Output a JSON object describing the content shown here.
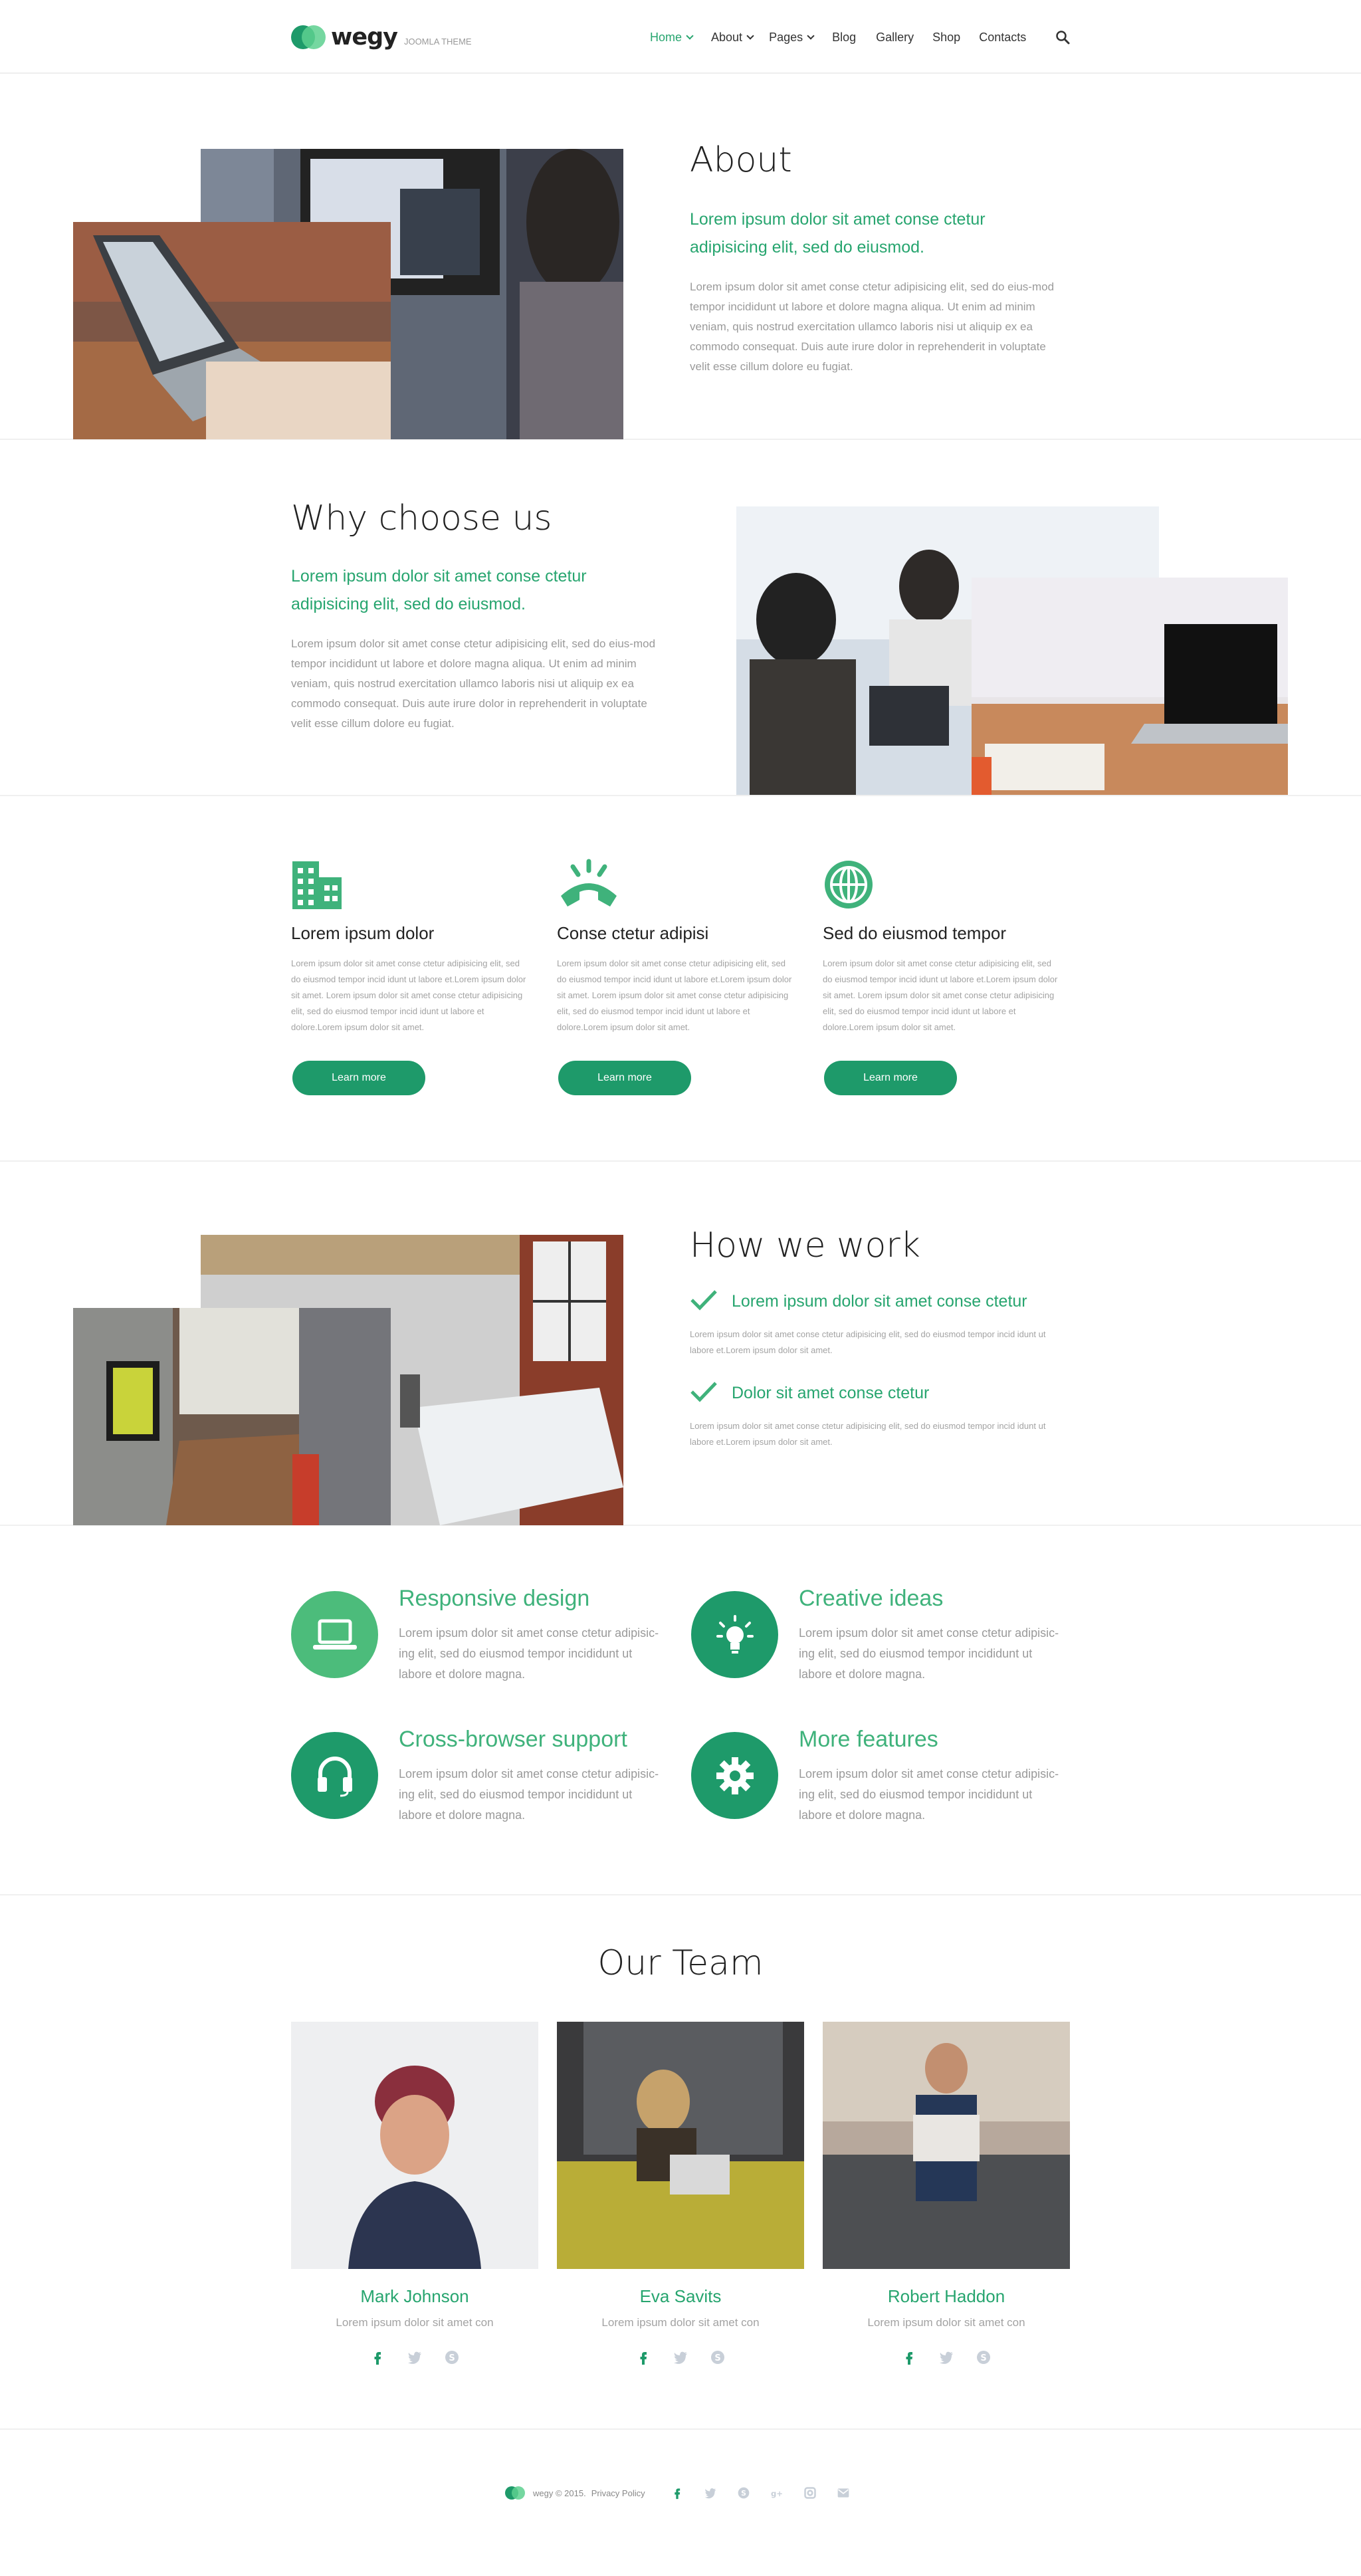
{
  "brand": {
    "name": "wegy",
    "tagline": "JOOMLA THEME"
  },
  "nav": [
    {
      "label": "Home",
      "dropdown": true,
      "active": true
    },
    {
      "label": "About",
      "dropdown": true
    },
    {
      "label": "Pages",
      "dropdown": true
    },
    {
      "label": "Blog"
    },
    {
      "label": "Gallery"
    },
    {
      "label": "Shop"
    },
    {
      "label": "Contacts"
    }
  ],
  "about": {
    "title": "About",
    "lead": "Lorem ipsum dolor sit amet conse ctetur adipisicing elit, sed do eiusmod.",
    "body": "Lorem ipsum dolor sit amet conse ctetur adipisicing elit, sed do eius-mod tempor incididunt ut labore et dolore magna aliqua. Ut enim ad minim veniam, quis nostrud exercitation ullamco laboris nisi ut aliquip ex ea commodo consequat. Duis aute irure dolor in reprehenderit in voluptate velit esse cillum dolore eu fugiat."
  },
  "why": {
    "title": "Why choose us",
    "lead": "Lorem ipsum dolor sit amet conse ctetur adipisicing elit, sed do eiusmod.",
    "body": "Lorem ipsum dolor sit amet conse ctetur adipisicing elit, sed do eius-mod tempor incididunt ut labore et dolore magna aliqua. Ut enim ad minim veniam, quis nostrud exercitation ullamco laboris nisi ut aliquip ex ea commodo consequat. Duis aute irure dolor in reprehenderit in voluptate velit esse cillum dolore eu fugiat."
  },
  "services": [
    {
      "icon": "building-icon",
      "title": "Lorem ipsum dolor",
      "body": "Lorem ipsum dolor sit amet conse ctetur adipisicing elit, sed do eiusmod tempor incid idunt ut labore et.Lorem ipsum dolor sit amet. Lorem ipsum dolor sit amet conse ctetur adipisicing elit, sed do eiusmod tempor incid idunt ut labore et dolore.Lorem ipsum dolor sit amet.",
      "button": "Learn more"
    },
    {
      "icon": "phone-icon",
      "title": "Conse ctetur adipisi",
      "body": "Lorem ipsum dolor sit amet conse ctetur adipisicing elit, sed do eiusmod tempor incid idunt ut labore et.Lorem ipsum dolor sit amet. Lorem ipsum dolor sit amet conse ctetur adipisicing elit, sed do eiusmod tempor incid idunt ut labore et dolore.Lorem ipsum dolor sit amet.",
      "button": "Learn more"
    },
    {
      "icon": "globe-icon",
      "title": "Sed do eiusmod tempor",
      "body": "Lorem ipsum dolor sit amet conse ctetur adipisicing elit, sed do eiusmod tempor incid idunt ut labore et.Lorem ipsum dolor sit amet. Lorem ipsum dolor sit amet conse ctetur adipisicing elit, sed do eiusmod tempor incid idunt ut labore et dolore.Lorem ipsum dolor sit amet.",
      "button": "Learn more"
    }
  ],
  "how": {
    "title": "How we work",
    "items": [
      {
        "title": "Lorem ipsum dolor sit amet conse ctetur",
        "body": "Lorem ipsum dolor sit amet conse ctetur adipisicing elit, sed do eiusmod tempor incid idunt ut labore et.Lorem ipsum dolor sit amet."
      },
      {
        "title": "Dolor sit amet conse ctetur",
        "body": "Lorem ipsum dolor sit amet conse ctetur adipisicing elit, sed do eiusmod tempor incid idunt ut labore et.Lorem ipsum dolor sit amet."
      }
    ]
  },
  "features": [
    {
      "icon": "laptop-icon",
      "title": "Responsive design",
      "body": "Lorem ipsum dolor sit amet conse ctetur adipisic-ing elit, sed do eiusmod tempor incididunt ut labore et dolore magna."
    },
    {
      "icon": "lightbulb-icon",
      "title": "Creative ideas",
      "body": "Lorem ipsum dolor sit amet conse ctetur adipisic-ing elit, sed do eiusmod tempor incididunt ut labore et dolore magna."
    },
    {
      "icon": "headphones-icon",
      "title": "Cross-browser support",
      "body": "Lorem ipsum dolor sit amet conse ctetur adipisic-ing elit, sed do eiusmod tempor incididunt ut labore et dolore magna."
    },
    {
      "icon": "gear-icon",
      "title": "More features",
      "body": "Lorem ipsum dolor sit amet conse ctetur adipisic-ing elit, sed do eiusmod tempor incididunt ut labore et dolore magna."
    }
  ],
  "team": {
    "title": "Our Team",
    "members": [
      {
        "name": "Mark Johnson",
        "role": "Lorem ipsum dolor sit amet con"
      },
      {
        "name": "Eva Savits",
        "role": "Lorem ipsum dolor sit amet con"
      },
      {
        "name": "Robert Haddon",
        "role": "Lorem ipsum dolor sit amet con"
      }
    ]
  },
  "footer": {
    "copyright": "wegy © 2015.",
    "privacy": "Privacy Policy"
  },
  "colors": {
    "accent": "#1e9a6a",
    "accent_light": "#3fb27b"
  }
}
